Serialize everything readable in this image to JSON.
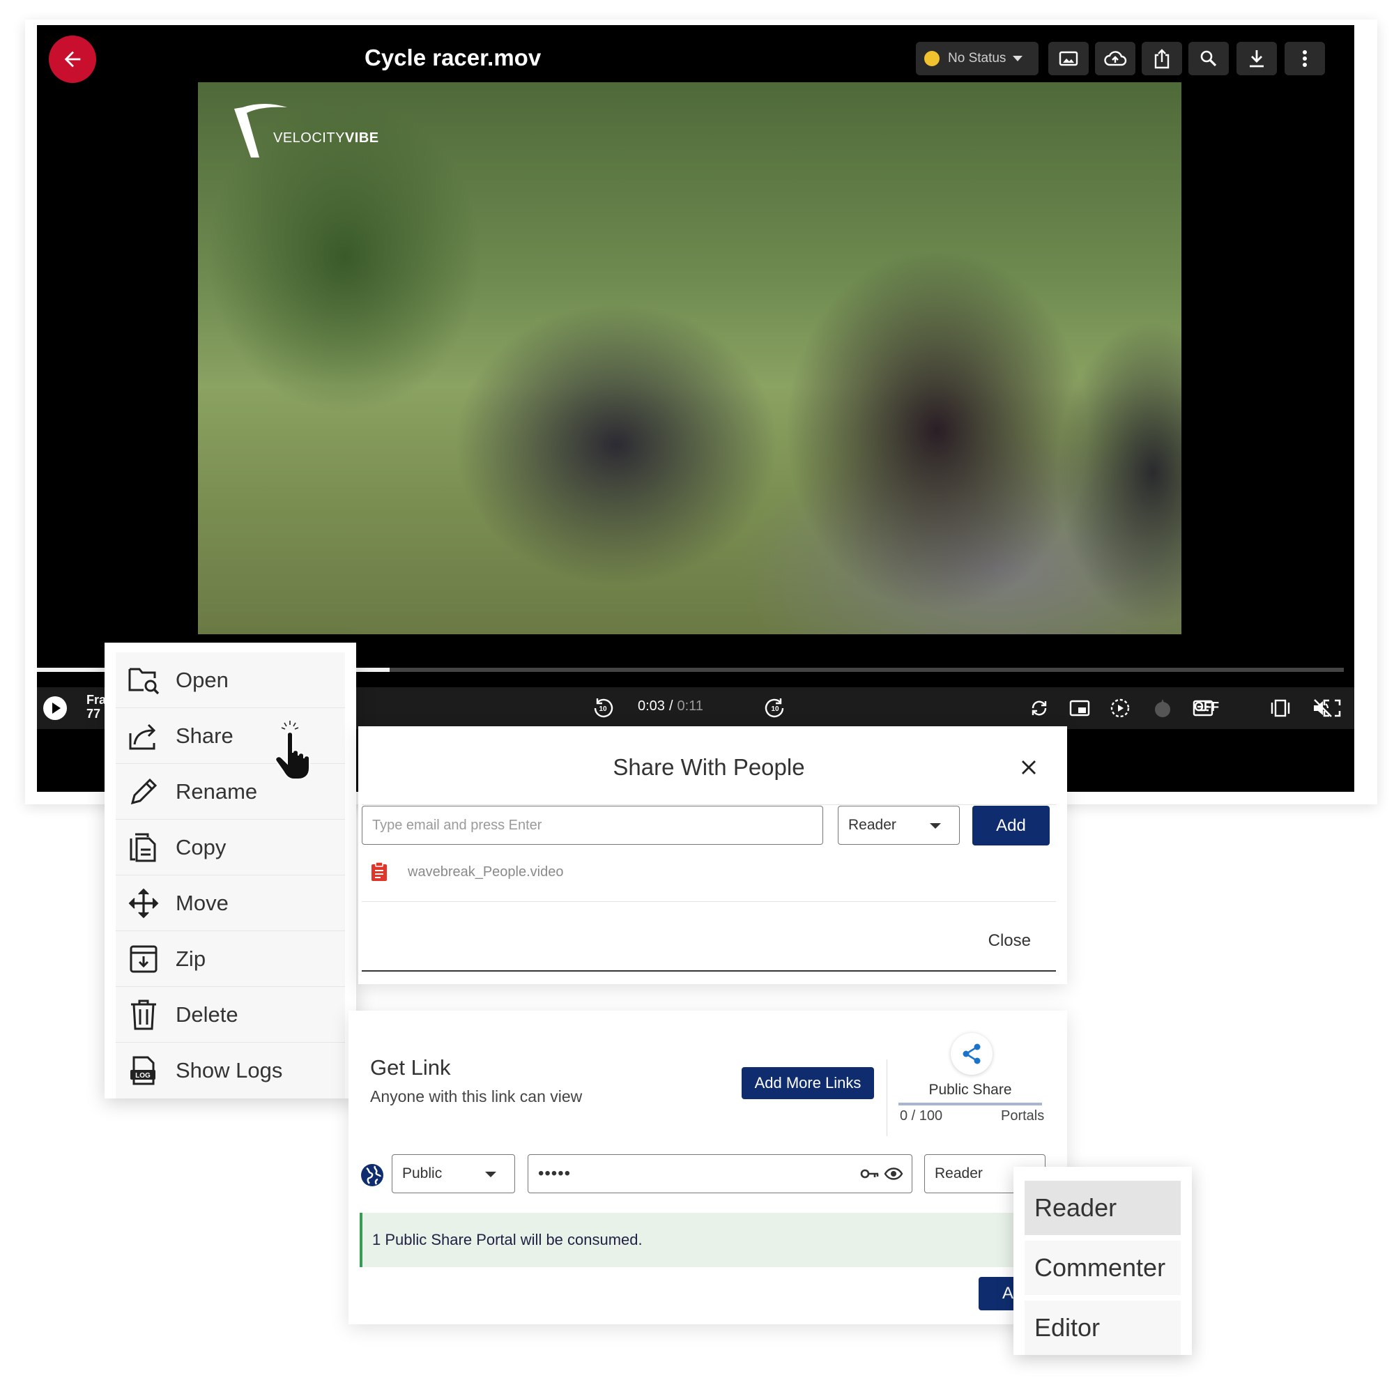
{
  "player": {
    "title": "Cycle racer.mov",
    "status_label": "No Status",
    "status_color": "#f2c12e",
    "brand_color": "#c8102e",
    "logo_text_light": "VELOCITY",
    "logo_text_bold": "VIBE",
    "frame_label_line1": "Fra",
    "frame_label_line2": "77",
    "time_current": "0:03",
    "time_separator": "/",
    "time_duration": "0:11",
    "progress_fraction": 0.27,
    "captions_state": "OFF",
    "toolbar_icons": [
      "image-icon",
      "cloud-upload-icon",
      "share-upload-icon",
      "zoom-icon",
      "download-icon",
      "more-vertical-icon"
    ]
  },
  "context_menu": {
    "items": [
      {
        "label": "Open",
        "icon": "open-folder-search-icon"
      },
      {
        "label": "Share",
        "icon": "share-arrow-icon"
      },
      {
        "label": "Rename",
        "icon": "pencil-icon"
      },
      {
        "label": "Copy",
        "icon": "copy-icon"
      },
      {
        "label": "Move",
        "icon": "move-arrows-icon"
      },
      {
        "label": "Zip",
        "icon": "zip-archive-icon"
      },
      {
        "label": "Delete",
        "icon": "trash-icon"
      },
      {
        "label": "Show Logs",
        "icon": "log-file-icon"
      }
    ]
  },
  "share_dialog": {
    "title": "Share With People",
    "email_placeholder": "Type email and press Enter",
    "role": "Reader",
    "add_label": "Add",
    "file_name": "wavebreak_People.video",
    "close_label": "Close"
  },
  "get_link": {
    "title": "Get Link",
    "subtitle": "Anyone with this link can view",
    "add_more_label": "Add More Links",
    "public_share_label": "Public Share",
    "count": "0 / 100",
    "portals_label": "Portals",
    "access": "Public",
    "password_mask": "•••••",
    "role": "Reader",
    "notice": "1 Public Share Portal will be consumed.",
    "add_label": "Ad"
  },
  "role_menu": {
    "options": [
      "Reader",
      "Commenter",
      "Editor"
    ],
    "selected": "Reader"
  }
}
